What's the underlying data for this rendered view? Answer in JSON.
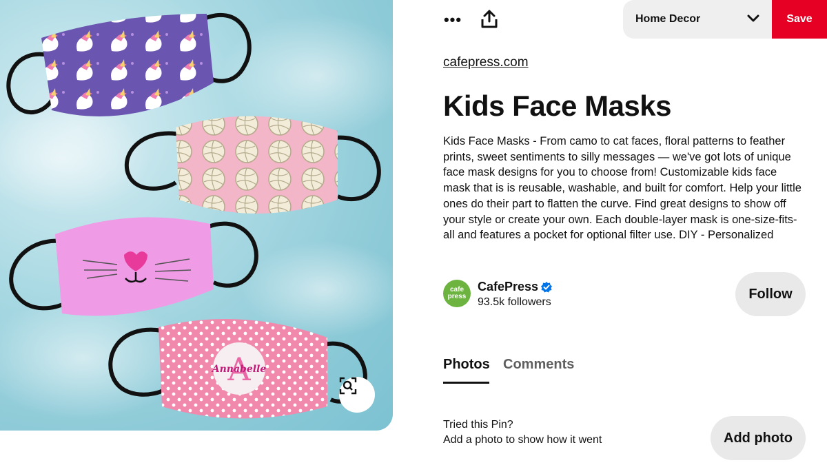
{
  "pin": {
    "source": "cafepress.com",
    "title": "Kids Face Masks",
    "description": "Kids Face Masks - From camo to cat faces, floral patterns to feather prints, sweet sentiments to silly messages — we've got lots of unique face mask designs for you to choose from! Customizable kids face mask that is is reusable, washable, and built for comfort. Help your little ones do their part to flatten the curve. Find great designs to show off your style or create your own. Each double-layer mask is one-size-fits-all and features a pocket for optional filter use. DIY - Personalized",
    "image_text": "Annabelle",
    "image_monogram": "A"
  },
  "toolbar": {
    "more_label": "•••",
    "board_name": "Home Decor",
    "save_label": "Save"
  },
  "creator": {
    "avatar_text_1": "cafe",
    "avatar_text_2": "press",
    "name": "CafePress",
    "followers": "93.5k followers",
    "follow_label": "Follow"
  },
  "tabs": [
    {
      "label": "Photos",
      "active": true
    },
    {
      "label": "Comments",
      "active": false
    }
  ],
  "tried": {
    "line1": "Tried this Pin?",
    "line2": "Add a photo to show how it went",
    "button": "Add photo"
  },
  "colors": {
    "save_red": "#e60023",
    "button_gray": "#e9e9e9",
    "verified_blue": "#0074e8",
    "cafepress_green": "#6cb43f"
  },
  "icons": [
    "more-icon",
    "share-icon",
    "chevron-down-icon",
    "verified-icon",
    "visual-search-icon"
  ]
}
